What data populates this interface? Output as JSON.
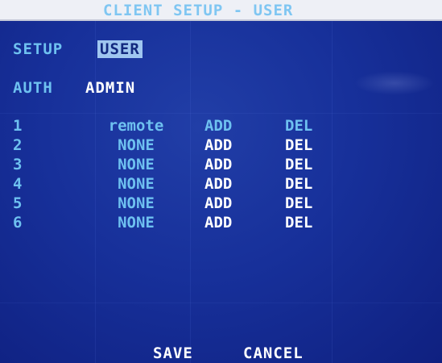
{
  "title": "CLIENT SETUP - USER",
  "setup": {
    "label": "SETUP",
    "value": "USER"
  },
  "auth": {
    "label": "AUTH",
    "value": "ADMIN"
  },
  "users": [
    {
      "num": "1",
      "name": "remote",
      "add": "ADD",
      "del": "DEL"
    },
    {
      "num": "2",
      "name": "NONE",
      "add": "ADD",
      "del": "DEL"
    },
    {
      "num": "3",
      "name": "NONE",
      "add": "ADD",
      "del": "DEL"
    },
    {
      "num": "4",
      "name": "NONE",
      "add": "ADD",
      "del": "DEL"
    },
    {
      "num": "5",
      "name": "NONE",
      "add": "ADD",
      "del": "DEL"
    },
    {
      "num": "6",
      "name": "NONE",
      "add": "ADD",
      "del": "DEL"
    }
  ],
  "footer": {
    "save": "SAVE",
    "cancel": "CANCEL"
  },
  "colors": {
    "background": "#17309a",
    "text_cyan": "#6ec1f0",
    "text_white": "#ffffff",
    "highlight": "#9fc6f0",
    "title_bar": "#eef0f6"
  }
}
